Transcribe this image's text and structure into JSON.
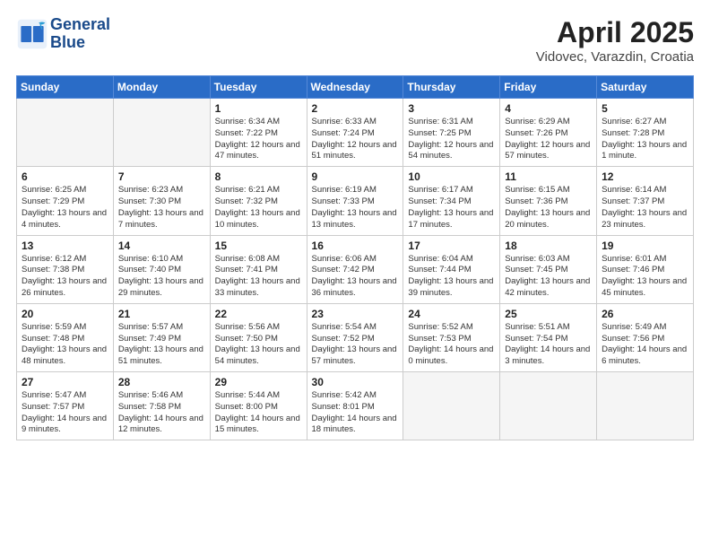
{
  "header": {
    "logo_line1": "General",
    "logo_line2": "Blue",
    "title": "April 2025",
    "location": "Vidovec, Varazdin, Croatia"
  },
  "columns": [
    "Sunday",
    "Monday",
    "Tuesday",
    "Wednesday",
    "Thursday",
    "Friday",
    "Saturday"
  ],
  "weeks": [
    [
      {
        "num": "",
        "detail": ""
      },
      {
        "num": "",
        "detail": ""
      },
      {
        "num": "1",
        "detail": "Sunrise: 6:34 AM\nSunset: 7:22 PM\nDaylight: 12 hours and 47 minutes."
      },
      {
        "num": "2",
        "detail": "Sunrise: 6:33 AM\nSunset: 7:24 PM\nDaylight: 12 hours and 51 minutes."
      },
      {
        "num": "3",
        "detail": "Sunrise: 6:31 AM\nSunset: 7:25 PM\nDaylight: 12 hours and 54 minutes."
      },
      {
        "num": "4",
        "detail": "Sunrise: 6:29 AM\nSunset: 7:26 PM\nDaylight: 12 hours and 57 minutes."
      },
      {
        "num": "5",
        "detail": "Sunrise: 6:27 AM\nSunset: 7:28 PM\nDaylight: 13 hours and 1 minute."
      }
    ],
    [
      {
        "num": "6",
        "detail": "Sunrise: 6:25 AM\nSunset: 7:29 PM\nDaylight: 13 hours and 4 minutes."
      },
      {
        "num": "7",
        "detail": "Sunrise: 6:23 AM\nSunset: 7:30 PM\nDaylight: 13 hours and 7 minutes."
      },
      {
        "num": "8",
        "detail": "Sunrise: 6:21 AM\nSunset: 7:32 PM\nDaylight: 13 hours and 10 minutes."
      },
      {
        "num": "9",
        "detail": "Sunrise: 6:19 AM\nSunset: 7:33 PM\nDaylight: 13 hours and 13 minutes."
      },
      {
        "num": "10",
        "detail": "Sunrise: 6:17 AM\nSunset: 7:34 PM\nDaylight: 13 hours and 17 minutes."
      },
      {
        "num": "11",
        "detail": "Sunrise: 6:15 AM\nSunset: 7:36 PM\nDaylight: 13 hours and 20 minutes."
      },
      {
        "num": "12",
        "detail": "Sunrise: 6:14 AM\nSunset: 7:37 PM\nDaylight: 13 hours and 23 minutes."
      }
    ],
    [
      {
        "num": "13",
        "detail": "Sunrise: 6:12 AM\nSunset: 7:38 PM\nDaylight: 13 hours and 26 minutes."
      },
      {
        "num": "14",
        "detail": "Sunrise: 6:10 AM\nSunset: 7:40 PM\nDaylight: 13 hours and 29 minutes."
      },
      {
        "num": "15",
        "detail": "Sunrise: 6:08 AM\nSunset: 7:41 PM\nDaylight: 13 hours and 33 minutes."
      },
      {
        "num": "16",
        "detail": "Sunrise: 6:06 AM\nSunset: 7:42 PM\nDaylight: 13 hours and 36 minutes."
      },
      {
        "num": "17",
        "detail": "Sunrise: 6:04 AM\nSunset: 7:44 PM\nDaylight: 13 hours and 39 minutes."
      },
      {
        "num": "18",
        "detail": "Sunrise: 6:03 AM\nSunset: 7:45 PM\nDaylight: 13 hours and 42 minutes."
      },
      {
        "num": "19",
        "detail": "Sunrise: 6:01 AM\nSunset: 7:46 PM\nDaylight: 13 hours and 45 minutes."
      }
    ],
    [
      {
        "num": "20",
        "detail": "Sunrise: 5:59 AM\nSunset: 7:48 PM\nDaylight: 13 hours and 48 minutes."
      },
      {
        "num": "21",
        "detail": "Sunrise: 5:57 AM\nSunset: 7:49 PM\nDaylight: 13 hours and 51 minutes."
      },
      {
        "num": "22",
        "detail": "Sunrise: 5:56 AM\nSunset: 7:50 PM\nDaylight: 13 hours and 54 minutes."
      },
      {
        "num": "23",
        "detail": "Sunrise: 5:54 AM\nSunset: 7:52 PM\nDaylight: 13 hours and 57 minutes."
      },
      {
        "num": "24",
        "detail": "Sunrise: 5:52 AM\nSunset: 7:53 PM\nDaylight: 14 hours and 0 minutes."
      },
      {
        "num": "25",
        "detail": "Sunrise: 5:51 AM\nSunset: 7:54 PM\nDaylight: 14 hours and 3 minutes."
      },
      {
        "num": "26",
        "detail": "Sunrise: 5:49 AM\nSunset: 7:56 PM\nDaylight: 14 hours and 6 minutes."
      }
    ],
    [
      {
        "num": "27",
        "detail": "Sunrise: 5:47 AM\nSunset: 7:57 PM\nDaylight: 14 hours and 9 minutes."
      },
      {
        "num": "28",
        "detail": "Sunrise: 5:46 AM\nSunset: 7:58 PM\nDaylight: 14 hours and 12 minutes."
      },
      {
        "num": "29",
        "detail": "Sunrise: 5:44 AM\nSunset: 8:00 PM\nDaylight: 14 hours and 15 minutes."
      },
      {
        "num": "30",
        "detail": "Sunrise: 5:42 AM\nSunset: 8:01 PM\nDaylight: 14 hours and 18 minutes."
      },
      {
        "num": "",
        "detail": ""
      },
      {
        "num": "",
        "detail": ""
      },
      {
        "num": "",
        "detail": ""
      }
    ]
  ]
}
